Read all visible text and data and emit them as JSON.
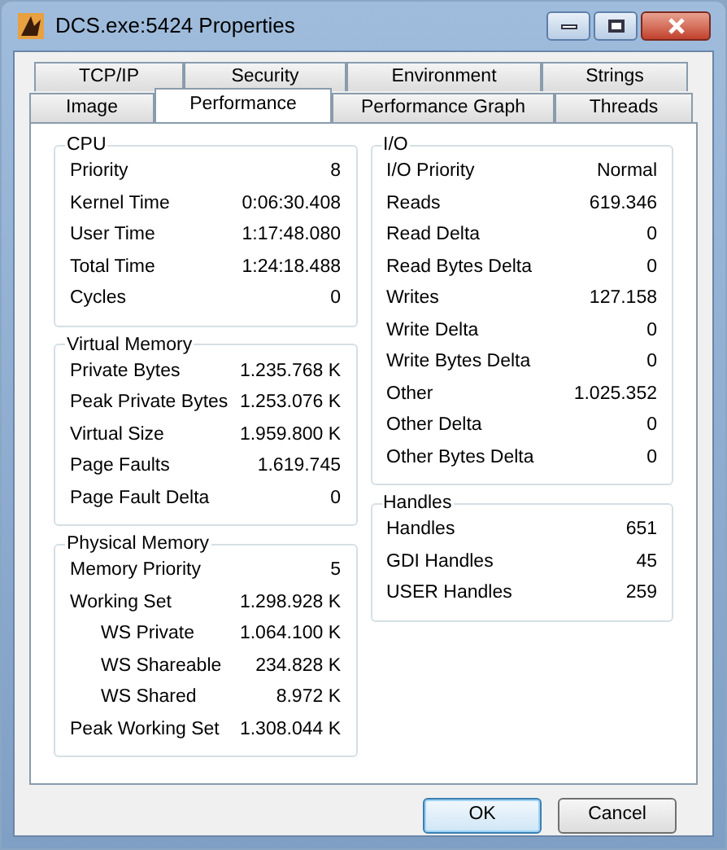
{
  "window": {
    "title": "DCS.exe:5424 Properties"
  },
  "tab_rows": [
    [
      {
        "label": "TCP/IP",
        "selected": false
      },
      {
        "label": "Security",
        "selected": false
      },
      {
        "label": "Environment",
        "selected": false
      },
      {
        "label": "Strings",
        "selected": false
      }
    ],
    [
      {
        "label": "Image",
        "selected": false
      },
      {
        "label": "Performance",
        "selected": true
      },
      {
        "label": "Performance Graph",
        "selected": false
      },
      {
        "label": "Threads",
        "selected": false
      }
    ]
  ],
  "left_groups": [
    {
      "title": "CPU",
      "rows": [
        {
          "label": "Priority",
          "value": "8",
          "kind": "main"
        },
        {
          "label": "Kernel Time",
          "value": "0:06:30.408",
          "kind": "main"
        },
        {
          "label": "User Time",
          "value": "1:17:48.080",
          "kind": "main"
        },
        {
          "label": "Total Time",
          "value": "1:24:18.488",
          "kind": "main"
        },
        {
          "label": "Cycles",
          "value": "0",
          "kind": "main"
        }
      ]
    },
    {
      "title": "Virtual Memory",
      "rows": [
        {
          "label": "Private Bytes",
          "value": "1.235.768 K",
          "kind": "main"
        },
        {
          "label": "Peak Private Bytes",
          "value": "1.253.076 K",
          "kind": "main"
        },
        {
          "label": "Virtual Size",
          "value": "1.959.800 K",
          "kind": "main"
        },
        {
          "label": "Page Faults",
          "value": "1.619.745",
          "kind": "main"
        },
        {
          "label": "Page Fault Delta",
          "value": "0",
          "kind": "main"
        }
      ]
    },
    {
      "title": "Physical Memory",
      "rows": [
        {
          "label": "Memory Priority",
          "value": "5",
          "kind": "main"
        },
        {
          "label": "Working Set",
          "value": "1.298.928 K",
          "kind": "main"
        },
        {
          "label": "WS Private",
          "value": "1.064.100 K",
          "kind": "sub"
        },
        {
          "label": "WS Shareable",
          "value": "234.828 K",
          "kind": "sub"
        },
        {
          "label": "WS Shared",
          "value": "8.972 K",
          "kind": "sub"
        },
        {
          "label": "Peak Working Set",
          "value": "1.308.044 K",
          "kind": "main"
        }
      ]
    }
  ],
  "right_groups": [
    {
      "title": "I/O",
      "rows": [
        {
          "label": "I/O Priority",
          "value": "Normal",
          "kind": "main"
        },
        {
          "label": "Reads",
          "value": "619.346",
          "kind": "main"
        },
        {
          "label": "Read Delta",
          "value": "0",
          "kind": "main"
        },
        {
          "label": "Read Bytes Delta",
          "value": "0",
          "kind": "main"
        },
        {
          "label": "Writes",
          "value": "127.158",
          "kind": "main"
        },
        {
          "label": "Write Delta",
          "value": "0",
          "kind": "main"
        },
        {
          "label": "Write Bytes Delta",
          "value": "0",
          "kind": "main"
        },
        {
          "label": "Other",
          "value": "1.025.352",
          "kind": "main"
        },
        {
          "label": "Other Delta",
          "value": "0",
          "kind": "main"
        },
        {
          "label": "Other Bytes Delta",
          "value": "0",
          "kind": "main"
        }
      ]
    },
    {
      "title": "Handles",
      "rows": [
        {
          "label": "Handles",
          "value": "651",
          "kind": "main"
        },
        {
          "label": "GDI Handles",
          "value": "45",
          "kind": "main"
        },
        {
          "label": "USER Handles",
          "value": "259",
          "kind": "main"
        }
      ]
    }
  ],
  "buttons": [
    {
      "label": "OK",
      "kind": "default"
    },
    {
      "label": "Cancel",
      "kind": "normal"
    }
  ]
}
